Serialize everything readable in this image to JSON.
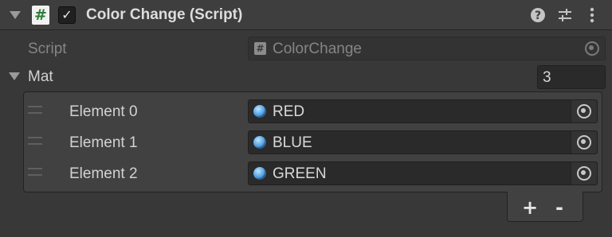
{
  "component": {
    "title": "Color Change (Script)",
    "enabled_check": "✓",
    "help_icon": "question-circle-icon",
    "settings_icon": "sliders-icon",
    "menu_icon": "kebab-menu-icon"
  },
  "script_field": {
    "label": "Script",
    "value": "ColorChange"
  },
  "mat": {
    "label": "Mat",
    "count": "3",
    "elements": [
      {
        "label": "Element 0",
        "value": "RED"
      },
      {
        "label": "Element 1",
        "value": "BLUE"
      },
      {
        "label": "Element 2",
        "value": "GREEN"
      }
    ],
    "add_label": "+",
    "remove_label": "-"
  }
}
